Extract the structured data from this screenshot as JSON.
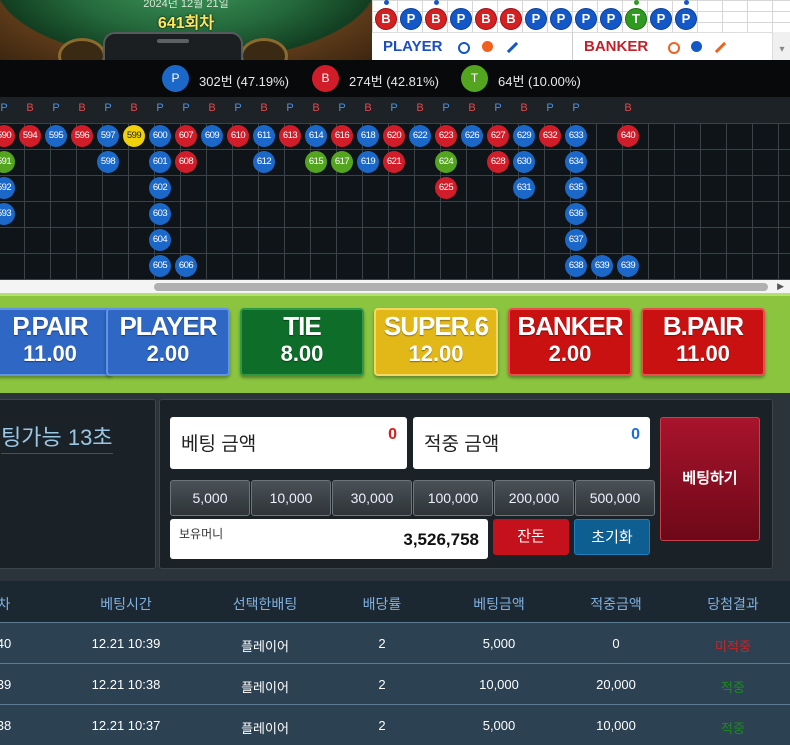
{
  "game_view": {
    "date_text": "2024년 12월 21일",
    "round_label": "641회차"
  },
  "mini_scoreboard": {
    "cells": [
      {
        "v": "B",
        "c": "b"
      },
      {
        "v": "P",
        "c": "p"
      },
      {
        "v": "B",
        "c": "b"
      },
      {
        "v": "P",
        "c": "p"
      },
      {
        "v": "B",
        "c": "b"
      },
      {
        "v": "B",
        "c": "b"
      },
      {
        "v": "P",
        "c": "p"
      },
      {
        "v": "P",
        "c": "p"
      },
      {
        "v": "P",
        "c": "p"
      },
      {
        "v": "P",
        "c": "p"
      },
      {
        "v": "T",
        "c": "t"
      },
      {
        "v": "P",
        "c": "p"
      },
      {
        "v": "P",
        "c": "p"
      }
    ],
    "player_label": "PLAYER",
    "banker_label": "BANKER",
    "scroll_icon": "▾"
  },
  "stats": [
    {
      "badge": "P",
      "text": "302번 (47.19%)",
      "color": "#1b68c9"
    },
    {
      "badge": "B",
      "text": "274번 (42.81%)",
      "color": "#d11d2a"
    },
    {
      "badge": "T",
      "text": "64번 (10.00%)",
      "color": "#53a51f"
    }
  ],
  "road": {
    "headers": [
      "P",
      "B",
      "P",
      "B",
      "P",
      "B",
      "P",
      "P",
      "B",
      "P",
      "B",
      "P",
      "B",
      "P",
      "B",
      "P",
      "B",
      "P",
      "B",
      "P",
      "B",
      "P",
      "P",
      "",
      "B"
    ],
    "columns": [
      [
        {
          "n": "590",
          "c": "b"
        },
        {
          "n": "591",
          "c": "t"
        },
        {
          "n": "592",
          "c": "p"
        },
        {
          "n": "593",
          "c": "p"
        }
      ],
      [
        {
          "n": "594",
          "c": "b"
        }
      ],
      [
        {
          "n": "595",
          "c": "p"
        }
      ],
      [
        {
          "n": "596",
          "c": "b"
        }
      ],
      [
        {
          "n": "597",
          "c": "p"
        },
        {
          "n": "598",
          "c": "p"
        }
      ],
      [
        {
          "n": "599",
          "c": "y"
        }
      ],
      [
        {
          "n": "600",
          "c": "p"
        },
        {
          "n": "601",
          "c": "p"
        },
        {
          "n": "602",
          "c": "p"
        },
        {
          "n": "603",
          "c": "p"
        },
        {
          "n": "604",
          "c": "p"
        },
        {
          "n": "605",
          "c": "p"
        }
      ],
      [
        {
          "n": "607",
          "c": "b"
        },
        {
          "n": "608",
          "c": "b"
        },
        null,
        null,
        null,
        {
          "n": "606",
          "c": "p"
        }
      ],
      [
        {
          "n": "609",
          "c": "p"
        }
      ],
      [
        {
          "n": "610",
          "c": "b"
        }
      ],
      [
        {
          "n": "611",
          "c": "p"
        },
        {
          "n": "612",
          "c": "p"
        }
      ],
      [
        {
          "n": "613",
          "c": "b"
        }
      ],
      [
        {
          "n": "614",
          "c": "p"
        },
        {
          "n": "615",
          "c": "t"
        }
      ],
      [
        {
          "n": "616",
          "c": "b"
        },
        {
          "n": "617",
          "c": "t"
        }
      ],
      [
        {
          "n": "618",
          "c": "p"
        },
        {
          "n": "619",
          "c": "p"
        }
      ],
      [
        {
          "n": "620",
          "c": "b"
        },
        {
          "n": "621",
          "c": "b"
        }
      ],
      [
        {
          "n": "622",
          "c": "p"
        }
      ],
      [
        {
          "n": "623",
          "c": "b"
        },
        {
          "n": "624",
          "c": "t"
        },
        {
          "n": "625",
          "c": "b"
        }
      ],
      [
        {
          "n": "626",
          "c": "p"
        }
      ],
      [
        {
          "n": "627",
          "c": "b"
        },
        {
          "n": "628",
          "c": "b"
        }
      ],
      [
        {
          "n": "629",
          "c": "p"
        },
        {
          "n": "630",
          "c": "p"
        },
        {
          "n": "631",
          "c": "p"
        }
      ],
      [
        {
          "n": "632",
          "c": "b"
        }
      ],
      [
        {
          "n": "633",
          "c": "p"
        },
        {
          "n": "634",
          "c": "p"
        },
        {
          "n": "635",
          "c": "p"
        },
        {
          "n": "636",
          "c": "p"
        },
        {
          "n": "637",
          "c": "p"
        },
        {
          "n": "638",
          "c": "p"
        }
      ],
      [
        null,
        null,
        null,
        null,
        null,
        {
          "n": "639",
          "c": "p"
        }
      ],
      [
        {
          "n": "640",
          "c": "b"
        },
        null,
        null,
        null,
        null,
        {
          "n": "639",
          "c": "p"
        }
      ]
    ]
  },
  "bet_options": [
    {
      "name": "P.PAIR",
      "odds": "11.00",
      "color": "blue"
    },
    {
      "name": "PLAYER",
      "odds": "2.00",
      "color": "blue"
    },
    {
      "name": "TIE",
      "odds": "8.00",
      "color": "green"
    },
    {
      "name": "SUPER.6",
      "odds": "12.00",
      "color": "yellow"
    },
    {
      "name": "BANKER",
      "odds": "2.00",
      "color": "red"
    },
    {
      "name": "B.PAIR",
      "odds": "11.00",
      "color": "red"
    }
  ],
  "timer_text": "팅가능 13초",
  "bet_panel": {
    "bet_amount_label": "베팅 금액",
    "bet_amount_value": "0",
    "win_amount_label": "적중 금액",
    "win_amount_value": "0",
    "chips": [
      "5,000",
      "10,000",
      "30,000",
      "100,000",
      "200,000",
      "500,000"
    ],
    "money_label": "보유머니",
    "money_value": "3,526,758",
    "change_label": "잔돈",
    "reset_label": "초기화",
    "place_bet_label": "베팅하기"
  },
  "history": {
    "headers": [
      "차",
      "베팅시간",
      "선택한배팅",
      "배당률",
      "베팅금액",
      "적중금액",
      "당첨결과"
    ],
    "rows": [
      [
        "40",
        "12.21 10:39",
        "플레이어",
        "2",
        "5,000",
        "0",
        "미적중"
      ],
      [
        "39",
        "12.21 10:38",
        "플레이어",
        "2",
        "10,000",
        "20,000",
        "적중"
      ],
      [
        "38",
        "12.21 10:37",
        "플레이어",
        "2",
        "5,000",
        "10,000",
        "적중"
      ]
    ]
  }
}
